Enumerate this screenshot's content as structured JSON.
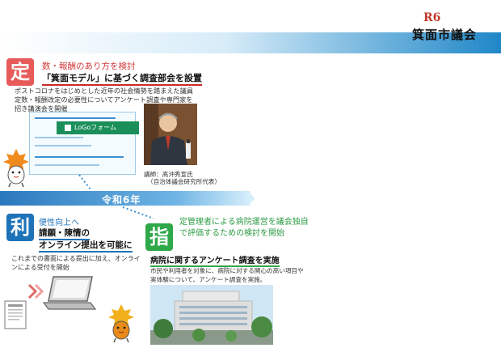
{
  "header": {
    "year": "R6",
    "title": "箕面市議会"
  },
  "section_teitei": {
    "badge": "定",
    "subtitle": "数・報酬のあり方を検討",
    "heading": "「箕面モデル」に基づく調査部会を設置",
    "description": "ポストコロナをはじめとした近年の社会情勢を踏まえた議員定数・報酬改定の必要性についてアンケート調査や専門家を招き講演会を開催",
    "form_title": "LoGoフォーム",
    "speaker_caption_1": "講師：髙沖秀宣氏",
    "speaker_caption_2": "（自治体議会研究所代表）"
  },
  "timeline": {
    "label": "令和6年"
  },
  "section_ri": {
    "badge": "利",
    "line1": "便性向上へ",
    "line2": "請願・陳情の",
    "line3": "オンライン提出を可能に",
    "description": "これまでの書面による提出に加え、オンラインによる受付を開始"
  },
  "section_shi": {
    "badge": "指",
    "subtitle": "定管理者による病院運営を議会独自で評価するための検討を開始",
    "heading": "病院に関するアンケート調査を実施",
    "description": "市民や利用者を対象に、病院に対する関心の高い項目や実体験について、アンケート調査を実施。"
  },
  "colors": {
    "teitei": "#e75a5a",
    "ri": "#1e73b8",
    "shi": "#2ea84a",
    "header_year": "#c0392b",
    "timeline_bar": "#2a78bd"
  },
  "icons": {
    "mascot": "maple-leaf-mascot-icon",
    "laptop": "laptop-icon",
    "document": "document-icon",
    "arrows": "forward-arrows-icon"
  }
}
